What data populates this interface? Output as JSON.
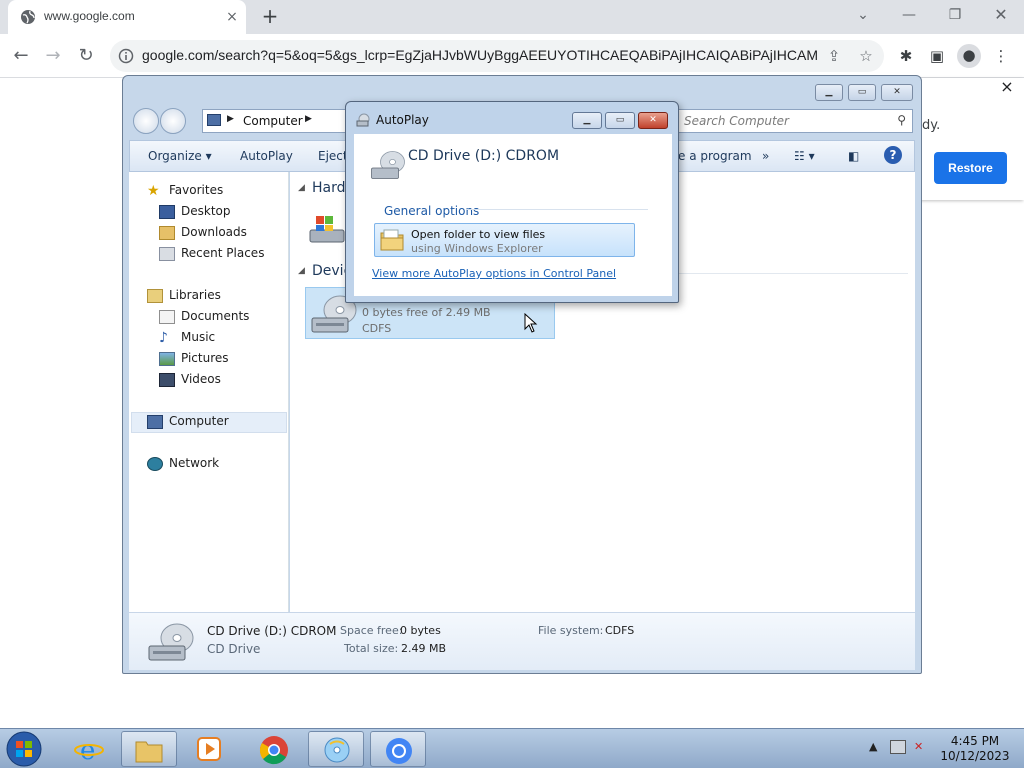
{
  "browser": {
    "tab_title": "www.google.com",
    "tab_close": "×",
    "new_tab": "+",
    "url": "google.com/search?q=5&oq=5&gs_lcrp=EgZjaHJvbWUyBggAEEUYOTIHCAEQABiPAjIHCAIQABiPAjIHCAMQ...",
    "notification": {
      "text_fragment": "dy.",
      "restore_label": "Restore",
      "close": "×"
    },
    "accent_color": "#1a73e8"
  },
  "explorer": {
    "address": {
      "location": "Computer",
      "search_placeholder": "Search Computer"
    },
    "commands": {
      "organize": "Organize",
      "autoplay": "AutoPlay",
      "eject": "Eject",
      "uninstall_fragment": "e a program",
      "more": "»"
    },
    "nav": {
      "favorites": "Favorites",
      "desktop": "Desktop",
      "downloads": "Downloads",
      "recent": "Recent Places",
      "libraries": "Libraries",
      "documents": "Documents",
      "music": "Music",
      "pictures": "Pictures",
      "videos": "Videos",
      "computer": "Computer",
      "network": "Network"
    },
    "groups": {
      "hard_fragment": "Hard",
      "devices_fragment": "Devic"
    },
    "cd_item": {
      "free_text": "0 bytes free of 2.49 MB",
      "filesystem": "CDFS"
    },
    "details": {
      "name": "CD Drive (D:) CDROM",
      "type": "CD Drive",
      "space_free_label": "Space free:",
      "space_free_value": "0 bytes",
      "total_size_label": "Total size:",
      "total_size_value": "2.49 MB",
      "fs_label": "File system:",
      "fs_value": "CDFS"
    }
  },
  "autoplay": {
    "caption": "AutoPlay",
    "drive_title": "CD Drive (D:) CDROM",
    "section": "General options",
    "option_title": "Open folder to view files",
    "option_sub": "using Windows Explorer",
    "link": "View more AutoPlay options in Control Panel"
  },
  "taskbar": {
    "time": "4:45 PM",
    "date": "10/12/2023"
  }
}
